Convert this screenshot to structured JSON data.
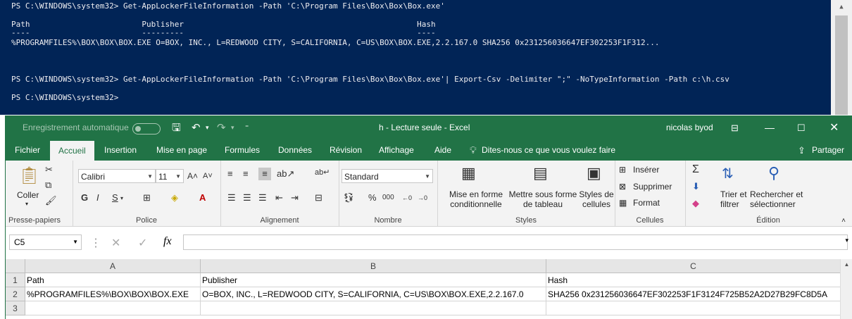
{
  "powershell": {
    "lines": [
      "PS C:\\WINDOWS\\system32> Get-AppLockerFileInformation -Path 'C:\\Program Files\\Box\\Box\\Box.exe'",
      "",
      "Path                        Publisher                                                  Hash",
      "----                        ---------                                                  ----",
      "%PROGRAMFILES%\\BOX\\BOX\\BOX.EXE O=BOX, INC., L=REDWOOD CITY, S=CALIFORNIA, C=US\\BOX\\BOX.EXE,2.2.167.0 SHA256 0x231256036647EF302253F1F312...",
      "",
      "",
      "PS C:\\WINDOWS\\system32> Get-AppLockerFileInformation -Path 'C:\\Program Files\\Box\\Box\\Box.exe'| Export-Csv -Delimiter \";\" -NoTypeInformation -Path c:\\h.csv",
      "",
      "PS C:\\WINDOWS\\system32>"
    ]
  },
  "excel": {
    "autosave_label": "Enregistrement automatique",
    "window_title": "h  -  Lecture seule  -  Excel",
    "user_name": "nicolas byod",
    "tabs": [
      "Fichier",
      "Accueil",
      "Insertion",
      "Mise en page",
      "Formules",
      "Données",
      "Révision",
      "Affichage",
      "Aide"
    ],
    "tell_me": "Dites-nous ce que vous voulez faire",
    "share_label": "Partager",
    "ribbon": {
      "clipboard": {
        "label": "Presse-papiers",
        "paste": "Coller"
      },
      "font": {
        "label": "Police",
        "name": "Calibri",
        "size": "11",
        "bold": "G",
        "italic": "I",
        "underline": "S"
      },
      "alignment": {
        "label": "Alignement"
      },
      "number": {
        "label": "Nombre",
        "format": "Standard",
        "percent": "%",
        "thousands": "000"
      },
      "styles": {
        "label": "Styles",
        "cond_format_1": "Mise en forme",
        "cond_format_2": "conditionnelle",
        "table_format_1": "Mettre sous forme",
        "table_format_2": "de tableau",
        "cell_styles_1": "Styles de",
        "cell_styles_2": "cellules"
      },
      "cells": {
        "label": "Cellules",
        "insert": "Insérer",
        "delete": "Supprimer",
        "format": "Format"
      },
      "editing": {
        "label": "Édition",
        "sort_1": "Trier et",
        "sort_2": "filtrer",
        "find_1": "Rechercher et",
        "find_2": "sélectionner"
      }
    },
    "name_box": "C5",
    "columns": [
      "A",
      "B",
      "C"
    ],
    "rows": [
      {
        "num": "1",
        "cells": [
          "Path",
          "Publisher",
          "Hash"
        ]
      },
      {
        "num": "2",
        "cells": [
          "%PROGRAMFILES%\\BOX\\BOX\\BOX.EXE",
          "O=BOX, INC., L=REDWOOD CITY, S=CALIFORNIA, C=US\\BOX\\BOX.EXE,2.2.167.0",
          "SHA256 0x231256036647EF302253F1F3124F725B52A2D27B29FC8D5A"
        ]
      },
      {
        "num": "3",
        "cells": [
          "",
          "",
          ""
        ]
      }
    ],
    "colors": {
      "accent": "#217346",
      "console_bg": "#012456"
    }
  }
}
